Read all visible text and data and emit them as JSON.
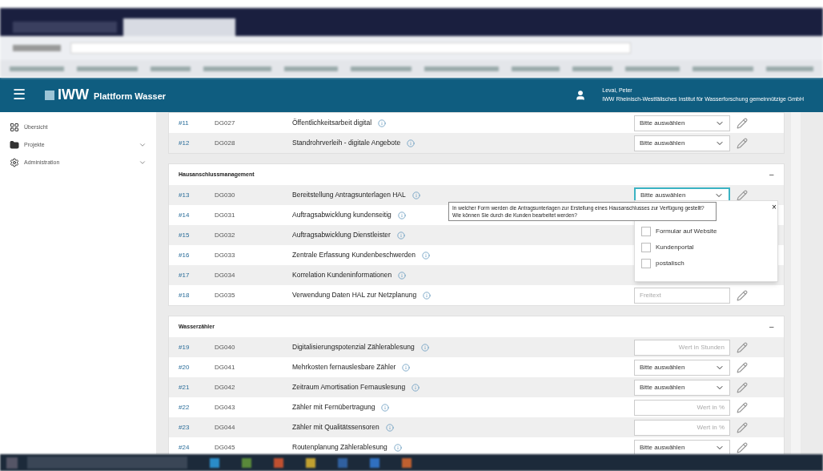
{
  "app_bar": {
    "menu": "☰",
    "brand": "IWW",
    "subtitle": "Plattform Wasser",
    "user_name": "Levai, Peter",
    "organization": "IWW Rheinisch-Westfälisches Institut für Wasserforschung gemeinnützige GmbH"
  },
  "sidebar": {
    "items": [
      {
        "label": "Übersicht",
        "kind": "grid",
        "expandable": false
      },
      {
        "label": "Projekte",
        "kind": "folder",
        "expandable": true
      },
      {
        "label": "Administration",
        "kind": "gear",
        "expandable": true
      }
    ]
  },
  "sections": [
    {
      "rows": [
        {
          "number": "#11",
          "code": "DG027",
          "name": "Öffentlichkeitsarbeit digital",
          "input": {
            "kind": "select",
            "value": "Bitte auswählen",
            "focused": false
          }
        },
        {
          "number": "#12",
          "code": "DG028",
          "name": "Standrohrverleih - digitale Angebote",
          "input": {
            "kind": "select",
            "value": "Bitte auswählen",
            "focused": false
          }
        }
      ]
    },
    {
      "title": "Hausanschlussmanagement",
      "toggle": "−",
      "rows": [
        {
          "number": "#13",
          "code": "DG030",
          "name": "Bereitstellung Antragsunterlagen HAL",
          "input": {
            "kind": "select",
            "value": "Bitte auswählen",
            "focused": true
          },
          "popup": {
            "tooltip": "In welcher Form werden die Antragsunterlagen zur Erstellung eines Hausanschlusses zur Verfügung gestellt? Wie können Sie durch die Kunden bearbeitet werden?",
            "close": "×",
            "options": [
              {
                "label": "Formular auf Website",
                "checked": false
              },
              {
                "label": "Kundenportal",
                "checked": false
              },
              {
                "label": "postalisch",
                "checked": false
              }
            ]
          }
        },
        {
          "number": "#14",
          "code": "DG031",
          "name": "Auftragsabwicklung kundenseitig"
        },
        {
          "number": "#15",
          "code": "DG032",
          "name": "Auftragsabwicklung Dienstleister"
        },
        {
          "number": "#16",
          "code": "DG033",
          "name": "Zentrale Erfassung Kundenbeschwerden"
        },
        {
          "number": "#17",
          "code": "DG034",
          "name": "Korrelation Kundeninformationen"
        },
        {
          "number": "#18",
          "code": "DG035",
          "name": "Verwendung Daten HAL zur Netzplanung",
          "input": {
            "kind": "text",
            "placeholder": "Freitext"
          }
        }
      ]
    },
    {
      "title": "Wasserzähler",
      "toggle": "−",
      "rows": [
        {
          "number": "#19",
          "code": "DG040",
          "name": "Digitalisierungspotenzial Zählerablesung",
          "input": {
            "kind": "number",
            "placeholder": "Wert in Stunden"
          }
        },
        {
          "number": "#20",
          "code": "DG041",
          "name": "Mehrkosten fernauslesbare Zähler",
          "input": {
            "kind": "select",
            "value": "Bitte auswählen",
            "focused": false
          }
        },
        {
          "number": "#21",
          "code": "DG042",
          "name": "Zeitraum Amortisation Fernauslesung",
          "input": {
            "kind": "select",
            "value": "Bitte auswählen",
            "focused": false
          }
        },
        {
          "number": "#22",
          "code": "DG043",
          "name": "Zähler mit Fernübertragung",
          "input": {
            "kind": "number",
            "placeholder": "Wert in %"
          }
        },
        {
          "number": "#23",
          "code": "DG044",
          "name": "Zähler mit Qualitätssensoren",
          "input": {
            "kind": "number",
            "placeholder": "Wert in %"
          }
        },
        {
          "number": "#24",
          "code": "DG045",
          "name": "Routenplanung Zählerablesung",
          "input": {
            "kind": "select",
            "value": "Bitte auswählen",
            "focused": false
          }
        }
      ]
    }
  ]
}
